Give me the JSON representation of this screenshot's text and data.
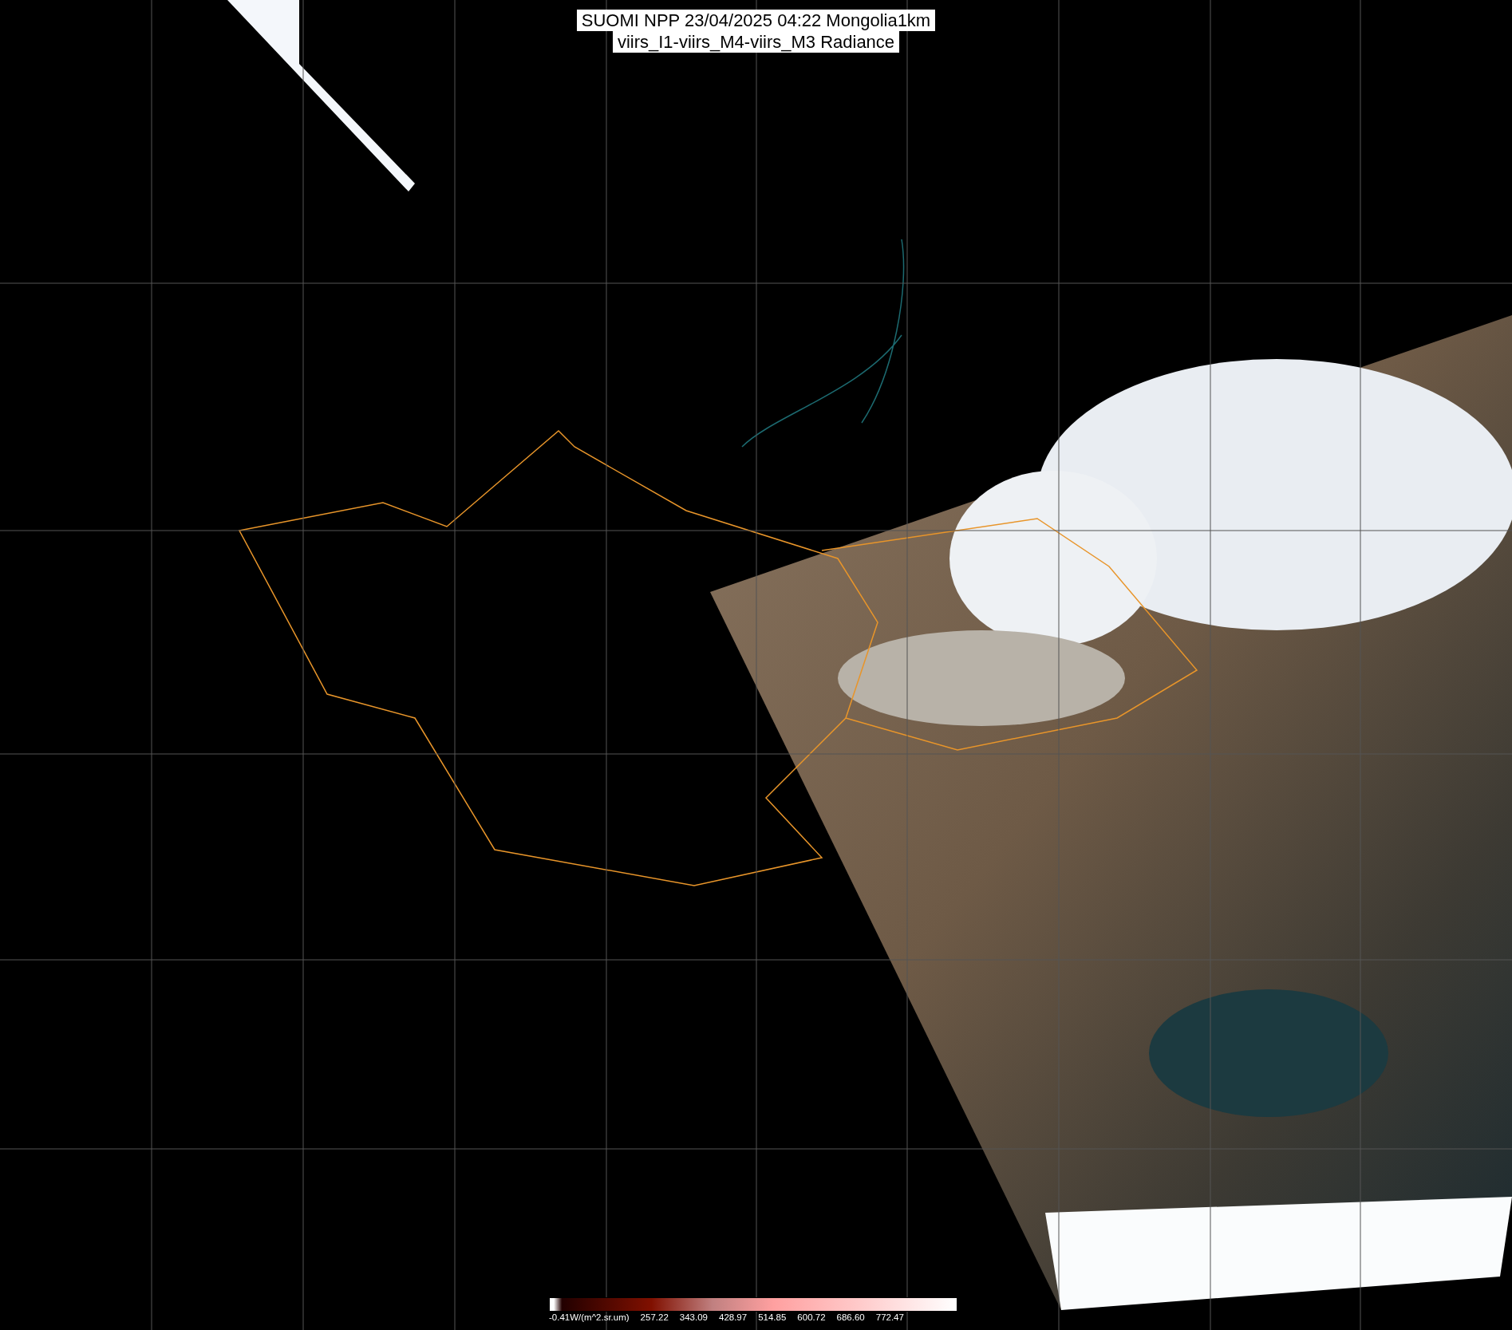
{
  "title": {
    "lines": [
      "SUOMI NPP 23/04/2025 04:22 Mongolia1km",
      "viirs_I1-viirs_M4-viirs_M3 Radiance"
    ]
  },
  "colorbar": {
    "labels": [
      "-0.41W/(m^2.sr.um)",
      "257.22",
      "343.09",
      "428.97",
      "514.85",
      "600.72",
      "686.60",
      "772.47"
    ]
  }
}
